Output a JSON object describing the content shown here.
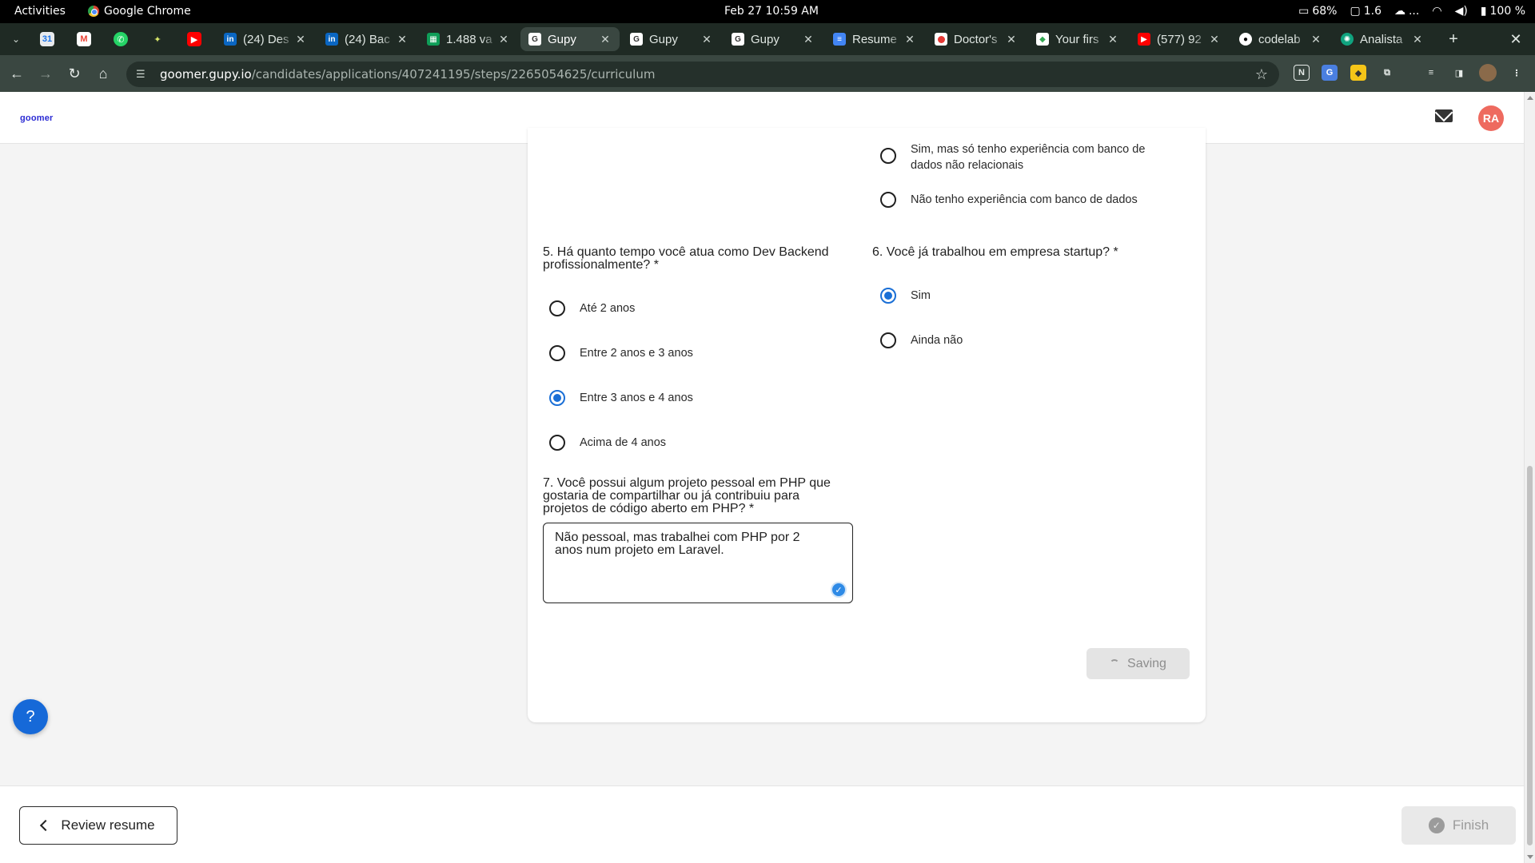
{
  "os": {
    "activities": "Activities",
    "app_name": "Google Chrome",
    "clock": "Feb 27  10:59 AM",
    "battery_gpu": "68%",
    "load": "1.6",
    "cloud": "...",
    "volume_battery": "100 %"
  },
  "tabs": {
    "items": [
      {
        "title": "(24) Des",
        "favicon": "linkedin-icon",
        "color": "#0a66c2"
      },
      {
        "title": "(24) Bac",
        "favicon": "linkedin-icon",
        "color": "#0a66c2"
      },
      {
        "title": "1.488 va",
        "favicon": "sheets-icon",
        "color": "#0f9d58"
      },
      {
        "title": "Gupy",
        "favicon": "gupy-icon",
        "color": "#ffffff",
        "active": true
      },
      {
        "title": "Gupy",
        "favicon": "gupy-icon",
        "color": "#ffffff"
      },
      {
        "title": "Gupy",
        "favicon": "gupy-icon",
        "color": "#ffffff"
      },
      {
        "title": "Resume",
        "favicon": "docs-icon",
        "color": "#4285f4"
      },
      {
        "title": "Doctor's",
        "favicon": "doctor-icon",
        "color": "#e53935"
      },
      {
        "title": "Your firs",
        "favicon": "course-icon",
        "color": "#34a853"
      },
      {
        "title": "(577) 92",
        "favicon": "youtube-icon",
        "color": "#ff0000"
      },
      {
        "title": "codelab",
        "favicon": "github-icon",
        "color": "#ffffff"
      },
      {
        "title": "Analista",
        "favicon": "chatgpt-icon",
        "color": "#10a37f"
      }
    ]
  },
  "toolbar": {
    "url_host": "goomer.gupy.io",
    "url_path": "/candidates/applications/407241195/steps/2265054625/curriculum"
  },
  "site": {
    "brand": "goomer",
    "avatar_initials": "RA",
    "accent": "#1a6fd6"
  },
  "form": {
    "prev_question": {
      "options": [
        {
          "label_line1": "Sim, mas só tenho experiência com banco de",
          "label_line2": "dados não relacionais",
          "checked": false
        },
        {
          "label_line1": "Não tenho experiência com banco de dados",
          "checked": false
        }
      ]
    },
    "q5": {
      "title_line1": "5. Há quanto tempo você atua como Dev Backend",
      "title_line2": "profissionalmente? *",
      "options": [
        {
          "label": "Até 2 anos",
          "checked": false
        },
        {
          "label": "Entre 2 anos e 3 anos",
          "checked": false
        },
        {
          "label": "Entre 3 anos e 4 anos",
          "checked": true
        },
        {
          "label": "Acima de 4 anos",
          "checked": false
        }
      ]
    },
    "q6": {
      "title": "6. Você já trabalhou em empresa startup? *",
      "options": [
        {
          "label": "Sim",
          "checked": true
        },
        {
          "label": "Ainda não",
          "checked": false
        }
      ]
    },
    "q7": {
      "title_line1": "7. Você possui algum projeto pessoal em PHP que",
      "title_line2": "gostaria de compartilhar ou já contribuiu para",
      "title_line3": "projetos de código aberto em PHP? *",
      "answer_line1": "Não pessoal, mas trabalhei com PHP por 2",
      "answer_line2": "anos num projeto em Laravel."
    },
    "saving_label": "Saving"
  },
  "help_label": "?",
  "footer": {
    "review_label": "Review resume",
    "finish_label": "Finish"
  }
}
